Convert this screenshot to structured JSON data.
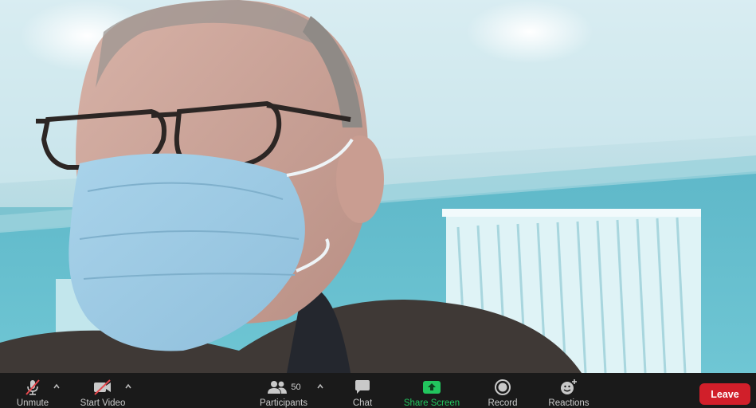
{
  "toolbar": {
    "unmute_label": "Unmute",
    "start_video_label": "Start Video",
    "participants_label": "Participants",
    "participants_count": "50",
    "chat_label": "Chat",
    "share_screen_label": "Share Screen",
    "record_label": "Record",
    "reactions_label": "Reactions",
    "leave_label": "Leave"
  },
  "colors": {
    "toolbar_bg": "#1a1a1a",
    "share_accent": "#22c55e",
    "leave_bg": "#d11f2a",
    "muted_slash": "#e5484d"
  },
  "icons": {
    "unmute": "microphone-muted-icon",
    "start_video": "video-camera-off-icon",
    "participants": "participants-icon",
    "chat": "chat-bubble-icon",
    "share_screen": "share-screen-icon",
    "record": "record-icon",
    "reactions": "reactions-icon"
  }
}
